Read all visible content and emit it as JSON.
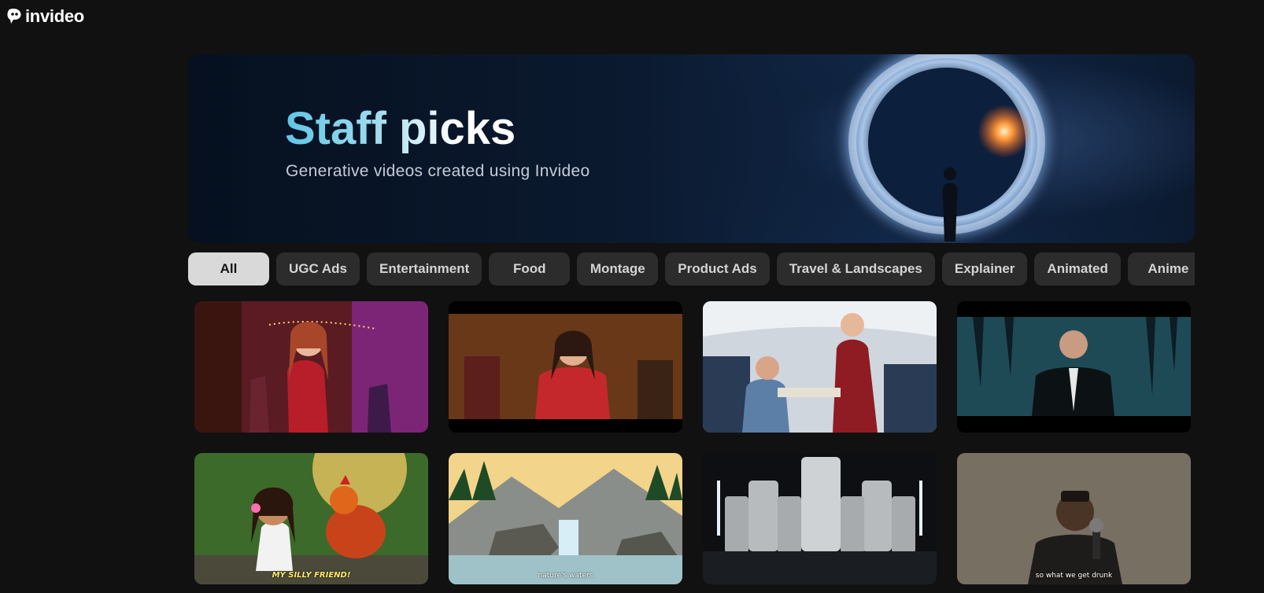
{
  "brand": {
    "name": "invideo",
    "logo_icon": "invideo-logo-icon"
  },
  "hero": {
    "title": "Staff picks",
    "subtitle": "Generative videos created using Invideo",
    "image": "portal-vortex-image"
  },
  "filters": {
    "selected": "All",
    "items": [
      "All",
      "UGC Ads",
      "Entertainment",
      "Food",
      "Montage",
      "Product Ads",
      "Travel & Landscapes",
      "Explainer",
      "Animated",
      "Anime",
      ""
    ]
  },
  "videos": [
    {
      "thumb": "party-woman-headphones-thumbnail",
      "caption": ""
    },
    {
      "thumb": "woman-eating-nachos-thumbnail",
      "caption": ""
    },
    {
      "thumb": "airplane-stewardess-thumbnail",
      "caption": ""
    },
    {
      "thumb": "man-in-suit-knives-thumbnail",
      "caption": ""
    },
    {
      "thumb": "animated-girl-rooster-thumbnail",
      "caption": "MY SILLY FRIEND!"
    },
    {
      "thumb": "mountain-waterfall-thumbnail",
      "caption": "nature's waters"
    },
    {
      "thumb": "liquid-death-cans-thumbnail",
      "caption": ""
    },
    {
      "thumb": "singer-microphone-thumbnail",
      "caption": "so what we get drunk"
    }
  ],
  "colors": {
    "background": "#111111",
    "chip": "#2c2c2c",
    "chip_active": "#d9d9d9",
    "accent": "#5fc6e6"
  }
}
